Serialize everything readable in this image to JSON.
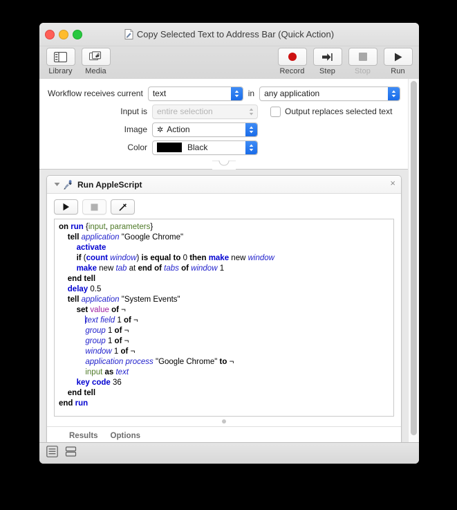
{
  "window": {
    "title": "Copy Selected Text to Address Bar (Quick Action)",
    "doc_icon": "script-document-icon",
    "traffic_lights": {
      "close": "close-button",
      "minimize": "minimize-button",
      "zoom": "zoom-button"
    }
  },
  "toolbar": {
    "left": [
      {
        "label": "Library",
        "icon": "library-panel-icon",
        "disabled": false
      },
      {
        "label": "Media",
        "icon": "media-browser-icon",
        "disabled": false
      }
    ],
    "right": [
      {
        "label": "Record",
        "icon": "record-circle-icon",
        "disabled": false
      },
      {
        "label": "Step",
        "icon": "step-arrow-icon",
        "disabled": false
      },
      {
        "label": "Stop",
        "icon": "stop-square-icon",
        "disabled": true
      },
      {
        "label": "Run",
        "icon": "run-triangle-icon",
        "disabled": false
      }
    ]
  },
  "settings": {
    "receives_label": "Workflow receives current",
    "receives_value": "text",
    "in_word": "in",
    "in_app_value": "any application",
    "input_is_label": "Input is",
    "input_is_value": "entire selection",
    "output_replaces_label": "Output replaces selected text",
    "output_replaces_checked": false,
    "image_label": "Image",
    "image_value": "Action",
    "color_label": "Color",
    "color_value": "Black",
    "color_swatch": "#000000"
  },
  "action": {
    "title": "Run AppleScript",
    "icon": "applescript-icon",
    "disclosure": "disclosure-triangle-open",
    "close": "×",
    "script_buttons": [
      {
        "name": "run-script-button",
        "icon": "play-triangle-icon",
        "disabled": false
      },
      {
        "name": "stop-script-button",
        "icon": "stop-square-icon",
        "disabled": true
      },
      {
        "name": "compile-script-button",
        "icon": "hammer-icon",
        "disabled": false
      }
    ],
    "footer_tabs": [
      "Results",
      "Options"
    ],
    "code_lines": [
      [
        {
          "t": "on ",
          "c": "k-ctl"
        },
        {
          "t": "run ",
          "c": "k-kw"
        },
        {
          "t": "{",
          "c": "k-cont"
        },
        {
          "t": "input",
          "c": "k-var"
        },
        {
          "t": ", ",
          "c": "k-cont"
        },
        {
          "t": "parameters",
          "c": "k-var"
        },
        {
          "t": "}",
          "c": "k-cont"
        }
      ],
      [
        {
          "t": "    ",
          "c": "k-cont"
        },
        {
          "t": "tell ",
          "c": "k-ctl"
        },
        {
          "t": "application",
          "c": "k-cls"
        },
        {
          "t": " \"Google Chrome\"",
          "c": "k-str"
        }
      ],
      [
        {
          "t": "        ",
          "c": "k-cont"
        },
        {
          "t": "activate",
          "c": "k-kw"
        }
      ],
      [
        {
          "t": "        ",
          "c": "k-cont"
        },
        {
          "t": "if ",
          "c": "k-ctl"
        },
        {
          "t": "(",
          "c": "k-cont"
        },
        {
          "t": "count ",
          "c": "k-kw"
        },
        {
          "t": "window",
          "c": "k-cls"
        },
        {
          "t": ") ",
          "c": "k-cont"
        },
        {
          "t": "is equal to ",
          "c": "k-ctl"
        },
        {
          "t": "0 ",
          "c": "k-num"
        },
        {
          "t": "then ",
          "c": "k-ctl"
        },
        {
          "t": "make ",
          "c": "k-kw"
        },
        {
          "t": "new ",
          "c": "k-cont"
        },
        {
          "t": "window",
          "c": "k-cls"
        }
      ],
      [
        {
          "t": "        ",
          "c": "k-cont"
        },
        {
          "t": "make ",
          "c": "k-kw"
        },
        {
          "t": "new ",
          "c": "k-cont"
        },
        {
          "t": "tab ",
          "c": "k-cls"
        },
        {
          "t": "at ",
          "c": "k-cont"
        },
        {
          "t": "end of ",
          "c": "k-ctl"
        },
        {
          "t": "tabs ",
          "c": "k-cls"
        },
        {
          "t": "of ",
          "c": "k-ctl"
        },
        {
          "t": "window ",
          "c": "k-cls"
        },
        {
          "t": "1",
          "c": "k-num"
        }
      ],
      [
        {
          "t": "    ",
          "c": "k-cont"
        },
        {
          "t": "end tell",
          "c": "k-ctl"
        }
      ],
      [
        {
          "t": "    ",
          "c": "k-cont"
        },
        {
          "t": "delay ",
          "c": "k-kw"
        },
        {
          "t": "0.5",
          "c": "k-num"
        }
      ],
      [
        {
          "t": "    ",
          "c": "k-cont"
        },
        {
          "t": "tell ",
          "c": "k-ctl"
        },
        {
          "t": "application",
          "c": "k-cls"
        },
        {
          "t": " \"System Events\"",
          "c": "k-str"
        }
      ],
      [
        {
          "t": "        ",
          "c": "k-cont"
        },
        {
          "t": "set ",
          "c": "k-ctl"
        },
        {
          "t": "value ",
          "c": "k-prop"
        },
        {
          "t": "of ",
          "c": "k-ctl"
        },
        {
          "t": "¬",
          "c": "k-cont"
        }
      ],
      [
        {
          "t": "            ",
          "c": "k-cont"
        },
        {
          "t": "|CARET|",
          "c": "caret-marker"
        },
        {
          "t": "text field ",
          "c": "k-cls"
        },
        {
          "t": "1 ",
          "c": "k-num"
        },
        {
          "t": "of ",
          "c": "k-ctl"
        },
        {
          "t": "¬",
          "c": "k-cont"
        }
      ],
      [
        {
          "t": "            ",
          "c": "k-cont"
        },
        {
          "t": "group ",
          "c": "k-cls"
        },
        {
          "t": "1 ",
          "c": "k-num"
        },
        {
          "t": "of ",
          "c": "k-ctl"
        },
        {
          "t": "¬",
          "c": "k-cont"
        }
      ],
      [
        {
          "t": "            ",
          "c": "k-cont"
        },
        {
          "t": "group ",
          "c": "k-cls"
        },
        {
          "t": "1 ",
          "c": "k-num"
        },
        {
          "t": "of ",
          "c": "k-ctl"
        },
        {
          "t": "¬",
          "c": "k-cont"
        }
      ],
      [
        {
          "t": "            ",
          "c": "k-cont"
        },
        {
          "t": "window ",
          "c": "k-cls"
        },
        {
          "t": "1 ",
          "c": "k-num"
        },
        {
          "t": "of ",
          "c": "k-ctl"
        },
        {
          "t": "¬",
          "c": "k-cont"
        }
      ],
      [
        {
          "t": "            ",
          "c": "k-cont"
        },
        {
          "t": "application process",
          "c": "k-cls"
        },
        {
          "t": " \"Google Chrome\" ",
          "c": "k-str"
        },
        {
          "t": "to ",
          "c": "k-ctl"
        },
        {
          "t": "¬",
          "c": "k-cont"
        }
      ],
      [
        {
          "t": "            ",
          "c": "k-cont"
        },
        {
          "t": "input ",
          "c": "k-var"
        },
        {
          "t": "as ",
          "c": "k-ctl"
        },
        {
          "t": "text",
          "c": "k-cls"
        }
      ],
      [
        {
          "t": "        ",
          "c": "k-cont"
        },
        {
          "t": "key code ",
          "c": "k-kw"
        },
        {
          "t": "36",
          "c": "k-num"
        }
      ],
      [
        {
          "t": "    ",
          "c": "k-cont"
        },
        {
          "t": "end tell",
          "c": "k-ctl"
        }
      ],
      [
        {
          "t": "end ",
          "c": "k-ctl"
        },
        {
          "t": "run",
          "c": "k-kw"
        }
      ]
    ]
  },
  "bottombar": {
    "items": [
      {
        "name": "log-view-button",
        "icon": "list-lines-icon"
      },
      {
        "name": "variables-view-button",
        "icon": "stacked-rows-icon"
      }
    ]
  }
}
